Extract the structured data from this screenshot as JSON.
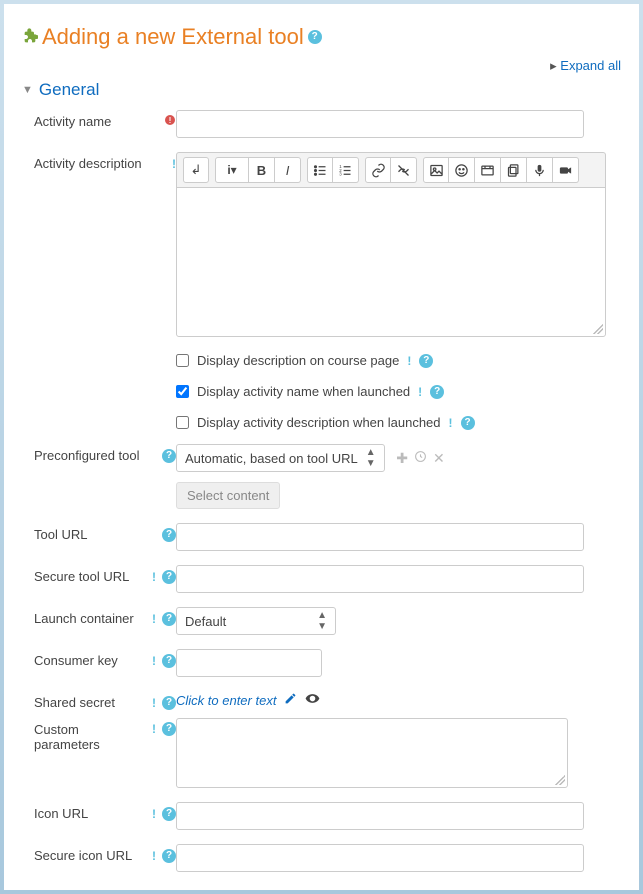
{
  "page": {
    "title": "Adding a new External tool",
    "expand_all": "Expand all"
  },
  "section": {
    "general": "General"
  },
  "labels": {
    "activity_name": "Activity name",
    "activity_description": "Activity description",
    "preconfigured_tool": "Preconfigured tool",
    "tool_url": "Tool URL",
    "secure_tool_url": "Secure tool URL",
    "launch_container": "Launch container",
    "consumer_key": "Consumer key",
    "shared_secret": "Shared secret",
    "custom_parameters": "Custom parameters",
    "icon_url": "Icon URL",
    "secure_icon_url": "Secure icon URL"
  },
  "checkboxes": {
    "display_desc_course": "Display description on course page",
    "display_name_launched": "Display activity name when launched",
    "display_desc_launched": "Display activity description when launched"
  },
  "preconfigured": {
    "selected": "Automatic, based on tool URL",
    "select_content_btn": "Select content"
  },
  "launch_container": {
    "selected": "Default"
  },
  "shared_secret": {
    "placeholder": "Click to enter text"
  },
  "values": {
    "activity_name": "",
    "tool_url": "",
    "secure_tool_url": "",
    "consumer_key": "",
    "custom_parameters": "",
    "icon_url": "",
    "secure_icon_url": ""
  }
}
